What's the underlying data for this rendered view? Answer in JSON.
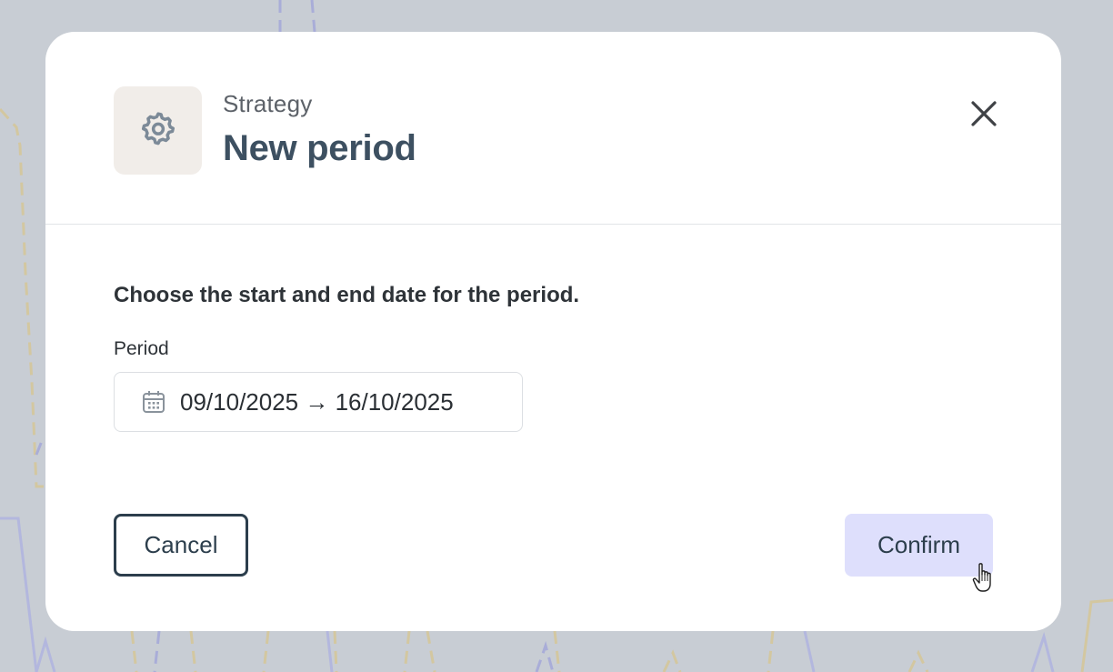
{
  "modal": {
    "eyebrow": "Strategy",
    "title": "New period",
    "header_icon": "gear-icon",
    "close_icon": "close-icon"
  },
  "form": {
    "instructions": "Choose the start and end date for the period.",
    "period_label": "Period",
    "period_value": "09/10/2025 → 16/10/2025",
    "period_icon": "calendar-icon"
  },
  "actions": {
    "cancel_label": "Cancel",
    "confirm_label": "Confirm"
  },
  "colors": {
    "backdrop": "#c8cdd4",
    "title": "#3d5061",
    "confirm_bg": "#dedffc",
    "cancel_border": "#2c3e4c",
    "icon_tile_bg": "#f1ede9"
  }
}
